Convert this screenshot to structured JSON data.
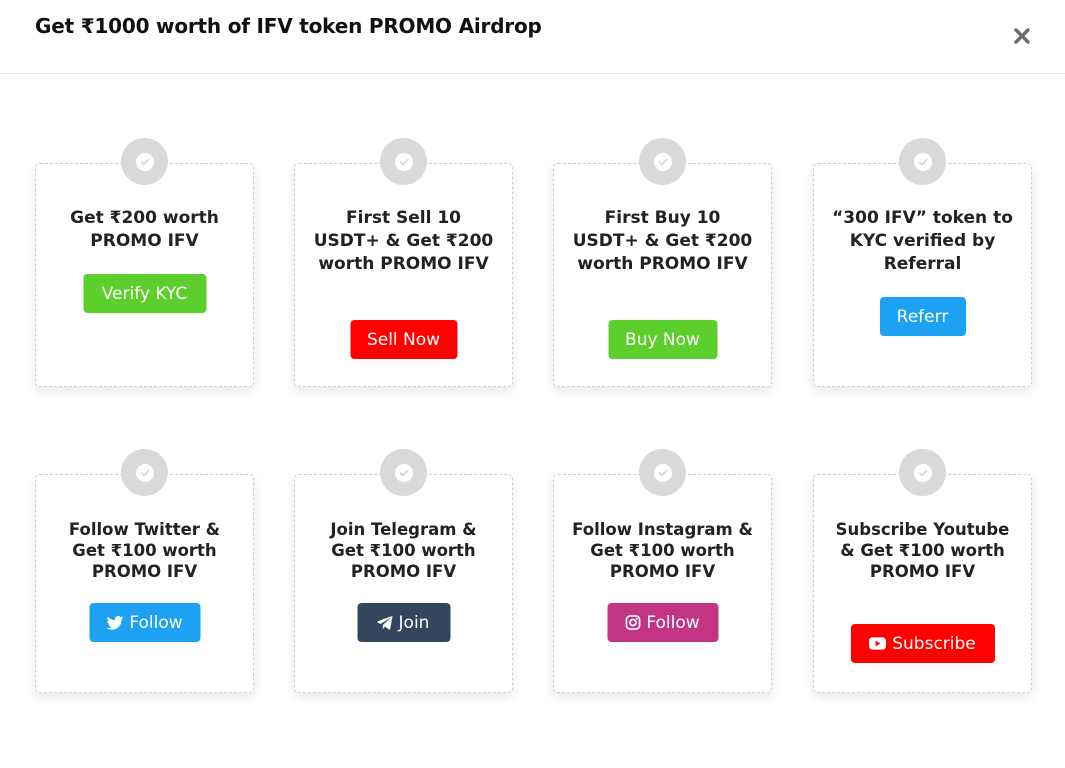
{
  "header": {
    "title": "Get ₹1000 worth of IFV token PROMO Airdrop"
  },
  "row1": [
    {
      "text": "Get ₹200 worth PROMO IFV",
      "button": "Verify KYC",
      "color": "#5ccf2c"
    },
    {
      "text": "First Sell 10 USDT+ & Get ₹200 worth PROMO IFV",
      "button": "Sell Now",
      "color": "#ff0000"
    },
    {
      "text": "First Buy 10 USDT+ & Get ₹200 worth PROMO IFV",
      "button": "Buy Now",
      "color": "#5ccf2c"
    },
    {
      "text": "“300 IFV” token to KYC verified by Referral",
      "button": "Referr",
      "color": "#1da1f2"
    }
  ],
  "row2": [
    {
      "text": "Follow Twitter & Get ₹100 worth PROMO IFV",
      "button": "Follow",
      "icon": "twitter-icon",
      "color": "#1da1f2"
    },
    {
      "text": "Join Telegram & Get ₹100 worth PROMO IFV",
      "button": "Join",
      "icon": "telegram-icon",
      "color": "#34465d"
    },
    {
      "text": "Follow Instagram & Get ₹100 worth PROMO IFV",
      "button": "Follow",
      "icon": "instagram-icon",
      "color": "#c13584"
    },
    {
      "text": "Subscribe Youtube & Get ₹100 worth PROMO IFV",
      "button": "Subscribe",
      "icon": "youtube-icon",
      "color": "#ff0000"
    }
  ]
}
